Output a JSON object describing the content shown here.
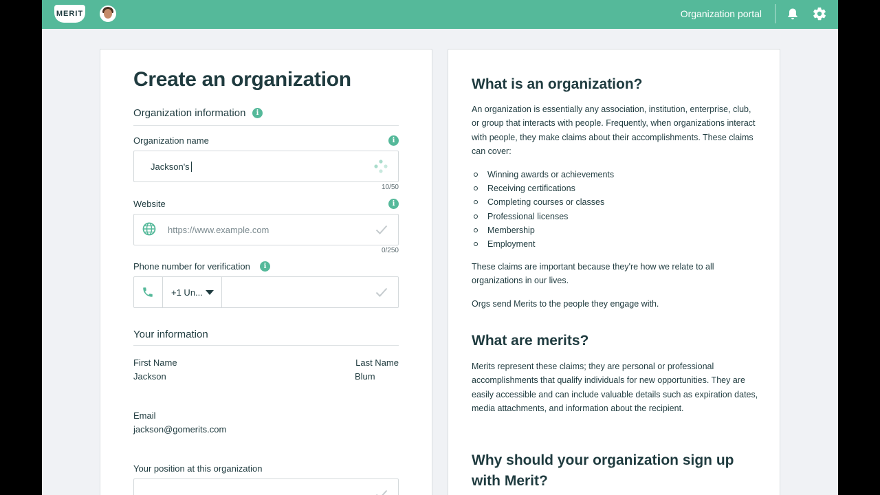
{
  "topbar": {
    "logo_text": "MERIT",
    "portal_label": "Organization portal",
    "icons": {
      "notifications": "bell-icon",
      "settings": "gear-icon"
    },
    "accent_color": "#55b99a"
  },
  "form": {
    "title": "Create an organization",
    "org_section": "Organization information",
    "org_name": {
      "label": "Organization name",
      "value": "Jackson's",
      "counter": "10/50"
    },
    "website": {
      "label": "Website",
      "placeholder": "https://www.example.com",
      "counter": "0/250"
    },
    "phone": {
      "label": "Phone number for verification",
      "country": "+1 Un..."
    },
    "your_section": "Your information",
    "first_name": {
      "label": "First Name",
      "value": "Jackson"
    },
    "last_name": {
      "label": "Last Name",
      "value": "Blum"
    },
    "email": {
      "label": "Email",
      "value": "jackson@gomerits.com"
    },
    "position": {
      "label": "Your position at this organization"
    }
  },
  "about": {
    "heading1": "What is an organization?",
    "para1": "An organization is essentially any association, institution, enterprise, club, or group that interacts with people. Frequently, when organizations interact with people, they make claims about their accomplishments. These claims can cover:",
    "list": [
      "Winning awards or achievements",
      "Receiving certifications",
      "Completing courses or classes",
      "Professional licenses",
      "Membership",
      "Employment"
    ],
    "para2": "These claims are important because they're how we relate to all organizations in our lives.",
    "para3": "Orgs send Merits to the people they engage with.",
    "heading2": "What are merits?",
    "para4": "Merits represent these claims; they are personal or professional accomplishments that qualify individuals for new opportunities. They are easily accessible and can include valuable details such as expiration dates, media attachments, and information about the recipient.",
    "heading3": "Why should your organization sign up with Merit?"
  }
}
